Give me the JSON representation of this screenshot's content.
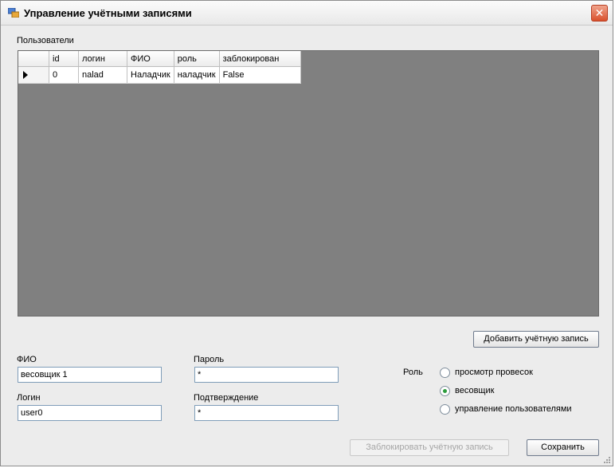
{
  "window": {
    "title": "Управление учётными записями"
  },
  "users": {
    "label": "Пользователи",
    "columns": [
      "id",
      "логин",
      "ФИО",
      "роль",
      "заблокирован"
    ],
    "rows": [
      {
        "id": "0",
        "login": "nalad",
        "fio": "Наладчик",
        "role": "наладчик",
        "blocked": "False"
      }
    ]
  },
  "buttons": {
    "add": "Добавить учётную запись",
    "block": "Заблокировать учётную запись",
    "save": "Сохранить"
  },
  "form": {
    "fio_label": "ФИО",
    "fio_value": "весовщик 1",
    "login_label": "Логин",
    "login_value": "user0",
    "password_label": "Пароль",
    "password_value": "*",
    "confirm_label": "Подтверждение",
    "confirm_value": "*"
  },
  "role": {
    "label": "Роль",
    "options": [
      "просмотр провесок",
      "весовщик",
      "управление пользователями"
    ],
    "selected_index": 1
  }
}
